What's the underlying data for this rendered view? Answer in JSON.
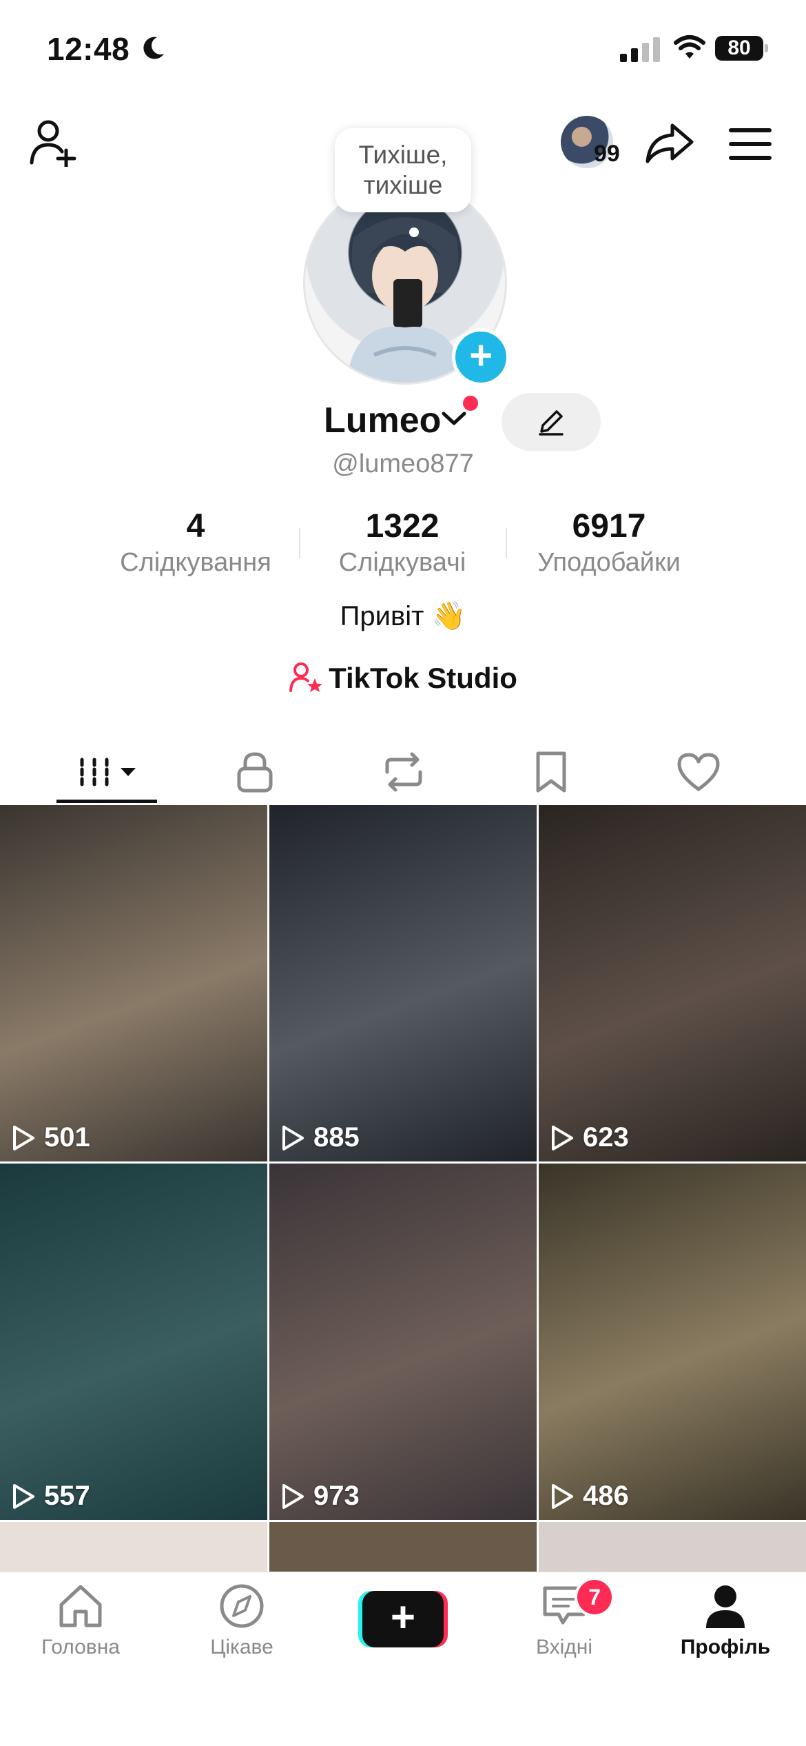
{
  "status_bar": {
    "time": "12:48",
    "battery": "80"
  },
  "header": {
    "friends_badge": "99"
  },
  "profile": {
    "bubble_line1": "Тихіше,",
    "bubble_line2": "тихіше",
    "name": "Lumeo",
    "handle": "@lumeo877",
    "bio": "Привіт 👋",
    "studio_label": "TikTok Studio"
  },
  "stats": [
    {
      "value": "4",
      "label": "Слідкування"
    },
    {
      "value": "1322",
      "label": "Слідкувачі"
    },
    {
      "value": "6917",
      "label": "Уподобайки"
    }
  ],
  "videos": [
    {
      "views": "501",
      "colors": [
        "#3a3530",
        "#8a7a68"
      ]
    },
    {
      "views": "885",
      "colors": [
        "#20242a",
        "#545a60"
      ]
    },
    {
      "views": "623",
      "colors": [
        "#2a2522",
        "#5e5048"
      ]
    },
    {
      "views": "557",
      "colors": [
        "#1a3a3e",
        "#3b5e60"
      ]
    },
    {
      "views": "973",
      "colors": [
        "#3a3438",
        "#6e5e58"
      ]
    },
    {
      "views": "486",
      "colors": [
        "#3a3428",
        "#8a7c60"
      ]
    }
  ],
  "nav": [
    {
      "label": "Головна"
    },
    {
      "label": "Цікаве"
    },
    {
      "label": "Вхідні"
    },
    {
      "label": "Профіль"
    }
  ],
  "inbox_badge": "7",
  "colors": {
    "accent": "#fe2c55",
    "cyan": "#25f4ee",
    "blue": "#20b8e6"
  }
}
